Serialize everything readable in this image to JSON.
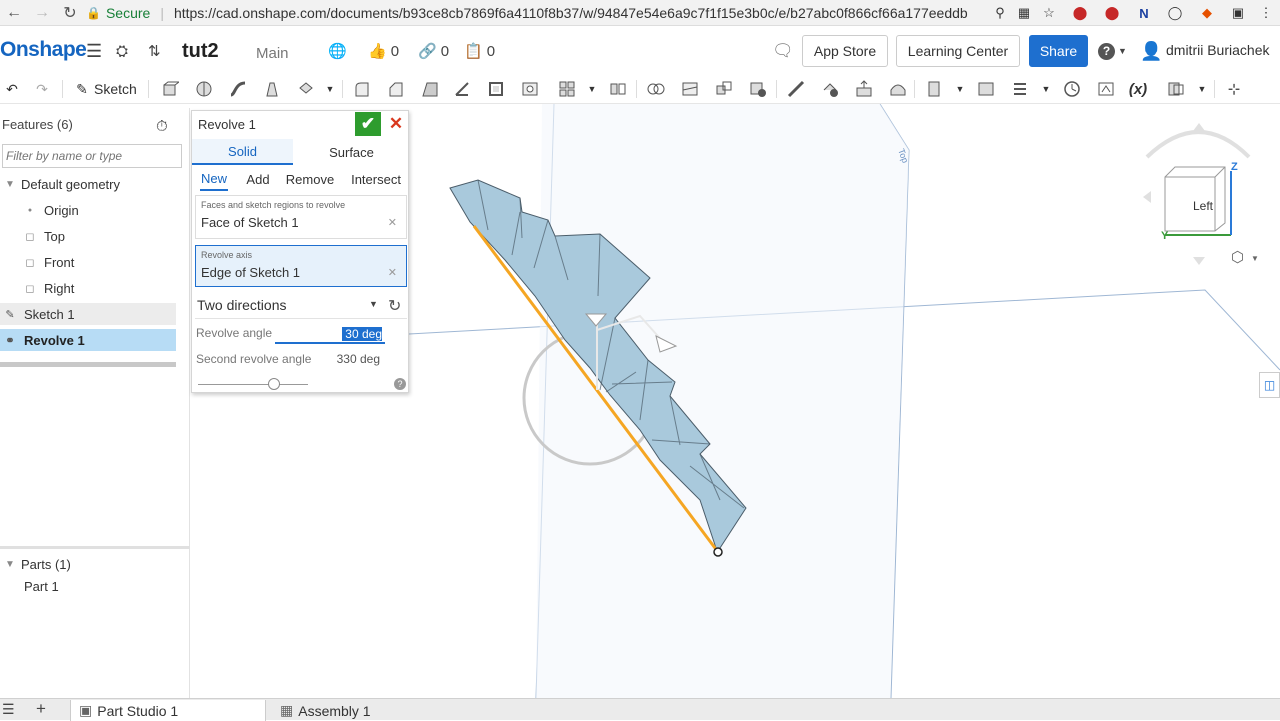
{
  "browser": {
    "secure_label": "Secure",
    "url": "https://cad.onshape.com/documents/b93ce8cb7869f6a4110f8b37/w/94847e54e6a9c7f1f15e3b0c/e/b27abc0f866cf66a177eeddb"
  },
  "header": {
    "logo": "Onshape",
    "doc_title": "tut2",
    "workspace": "Main",
    "likes": "0",
    "links": "0",
    "copies": "0",
    "app_store": "App Store",
    "learning_center": "Learning Center",
    "share": "Share",
    "user": "dmitrii Buriachek"
  },
  "toolbar": {
    "sketch_label": "Sketch"
  },
  "features": {
    "title": "Features (6)",
    "filter_placeholder": "Filter by name or type",
    "items": [
      {
        "label": "Default geometry"
      },
      {
        "label": "Origin"
      },
      {
        "label": "Top"
      },
      {
        "label": "Front"
      },
      {
        "label": "Right"
      },
      {
        "label": "Sketch 1"
      },
      {
        "label": "Revolve 1"
      }
    ],
    "parts_title": "Parts (1)",
    "parts": [
      {
        "label": "Part 1"
      }
    ]
  },
  "dialog": {
    "title": "Revolve 1",
    "tabs": [
      "Solid",
      "Surface"
    ],
    "ops": [
      "New",
      "Add",
      "Remove",
      "Intersect"
    ],
    "faces_label": "Faces and sketch regions to revolve",
    "faces_value": "Face of Sketch 1",
    "axis_label": "Revolve axis",
    "axis_value": "Edge of Sketch 1",
    "direction": "Two directions",
    "revolve_angle_label": "Revolve angle",
    "revolve_angle": "30 deg",
    "second_angle_label": "Second revolve angle",
    "second_angle": "330 deg",
    "help": "?"
  },
  "viewcube": {
    "face": "Left",
    "z": "Z",
    "y": "Y"
  },
  "bottom_tabs": [
    "Part Studio 1",
    "Assembly 1"
  ],
  "colors": {
    "accent": "#1e6fcf",
    "confirm": "#2e9c2e",
    "cancel": "#d9381e",
    "selected_row": "#b7dcf5",
    "part_fill": "#a9c9dc",
    "edge_highlight": "#f5a623"
  }
}
